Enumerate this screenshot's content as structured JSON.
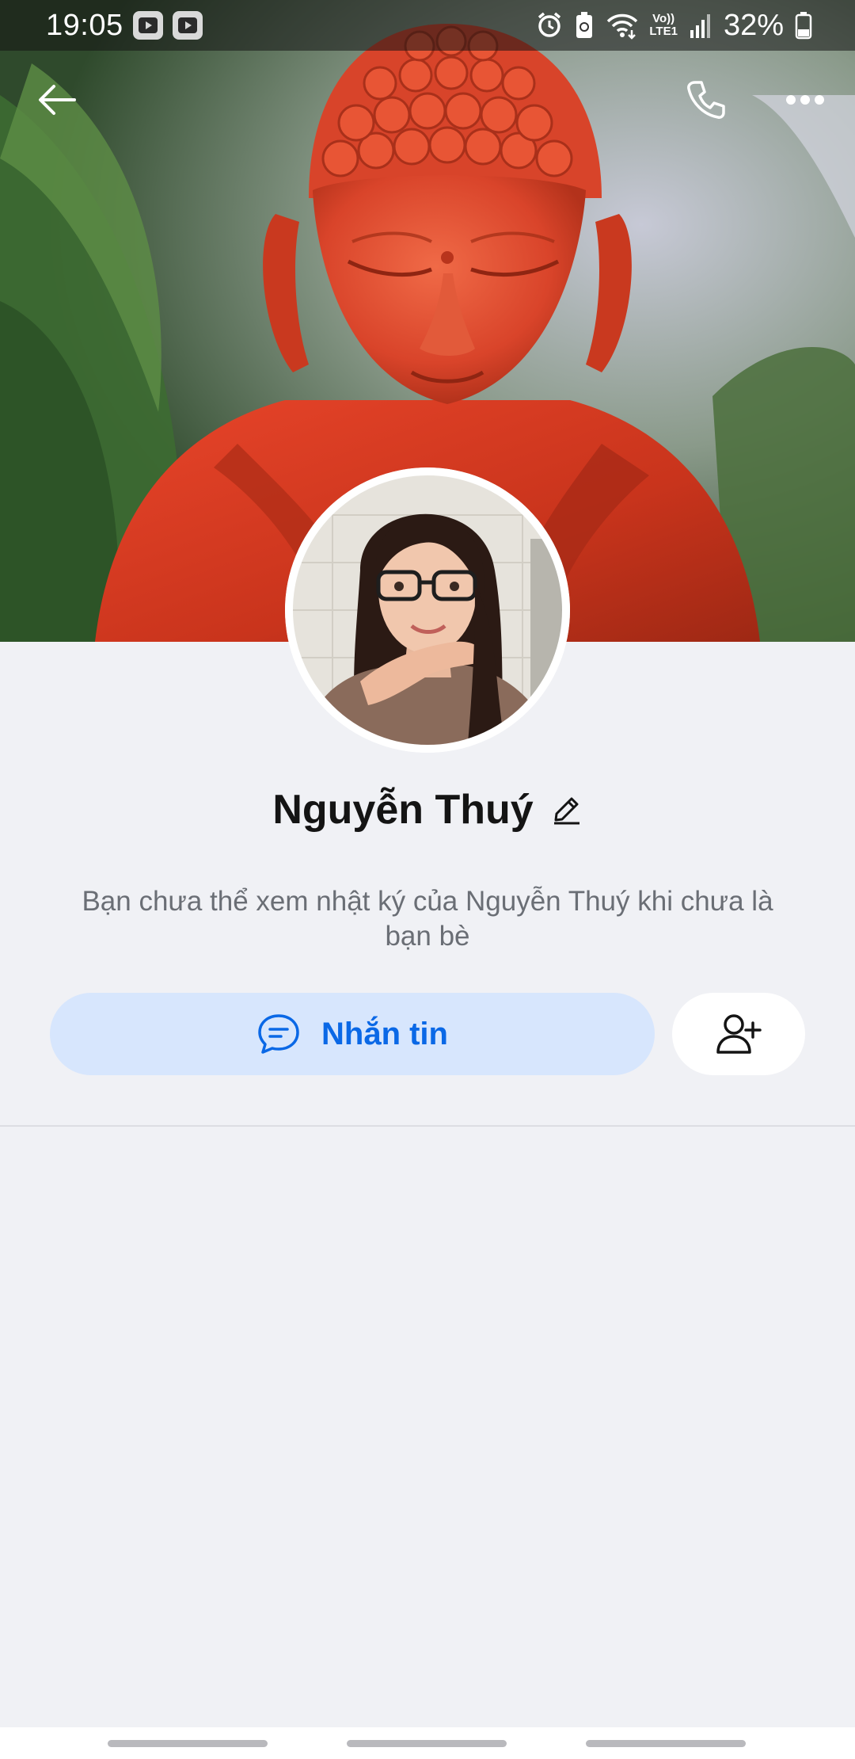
{
  "status_bar": {
    "time": "19:05",
    "network_label_top": "Vo))",
    "network_label_bottom": "LTE1",
    "battery_percent": "32%",
    "icons": [
      "video-app-icon",
      "video-app-icon",
      "alarm-icon",
      "recycle-battery-icon",
      "wifi-icon",
      "signal-icon",
      "battery-icon"
    ]
  },
  "header": {
    "icons": [
      "back-arrow-icon",
      "phone-icon",
      "more-icon"
    ]
  },
  "profile": {
    "name": "Nguyễn Thuý",
    "privacy_notice": "Bạn chưa thể xem nhật ký của Nguyễn Thuý khi chưa là bạn bè"
  },
  "actions": {
    "message_label": "Nhắn tin",
    "message_icon": "chat-bubble-icon",
    "add_friend_icon": "add-user-icon"
  },
  "colors": {
    "accent": "#0a68e6",
    "message_button_bg": "#d7e6fd",
    "page_bg": "#f0f1f5",
    "name_text": "#141414",
    "notice_text": "#6a6e75"
  }
}
